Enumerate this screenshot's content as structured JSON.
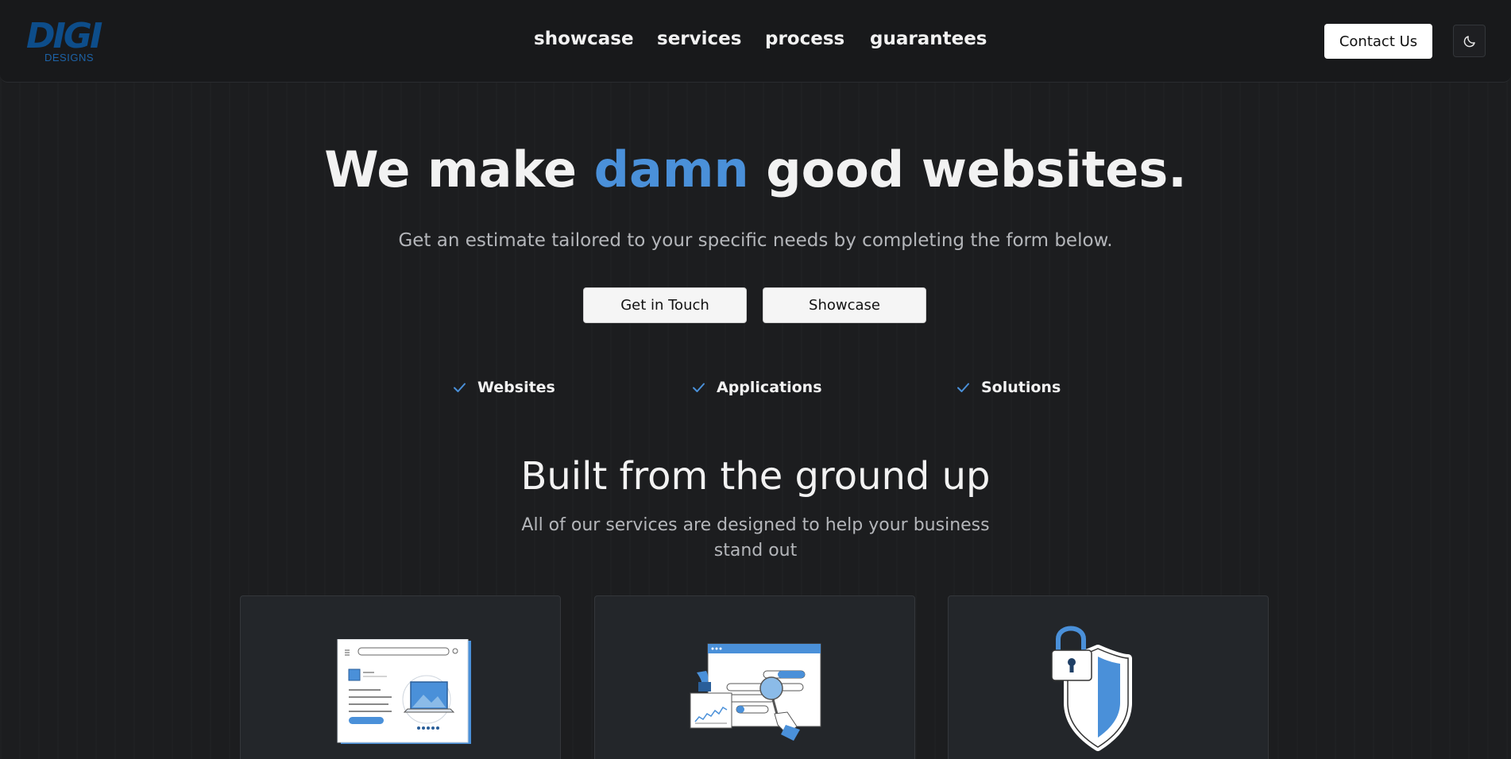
{
  "brand": {
    "logo_text": "DIGI",
    "logo_subtext": "DESIGNS"
  },
  "nav": {
    "items": [
      "showcase",
      "services",
      "process",
      "guarantees"
    ]
  },
  "header": {
    "contact_label": "Contact Us",
    "theme_toggle_icon": "moon-icon"
  },
  "hero": {
    "title_before": "We make",
    "title_accent": "damn",
    "title_after": "good websites.",
    "subtitle": "Get an estimate tailored to your specific needs by completing the form below.",
    "primary_button": "Get in Touch",
    "secondary_button": "Showcase",
    "features": [
      "Websites",
      "Applications",
      "Solutions"
    ]
  },
  "services": {
    "title": "Built from the ground up",
    "subtitle_line1": "All of our services are designed to help your business",
    "subtitle_line2": "stand out",
    "cards": [
      {
        "icon": "web-design-illustration-icon"
      },
      {
        "icon": "analytics-illustration-icon"
      },
      {
        "icon": "security-shield-lock-icon"
      }
    ]
  },
  "colors": {
    "accent": "#4a90d9",
    "logo": "#0d4d8a",
    "background": "#1c1d1f"
  }
}
